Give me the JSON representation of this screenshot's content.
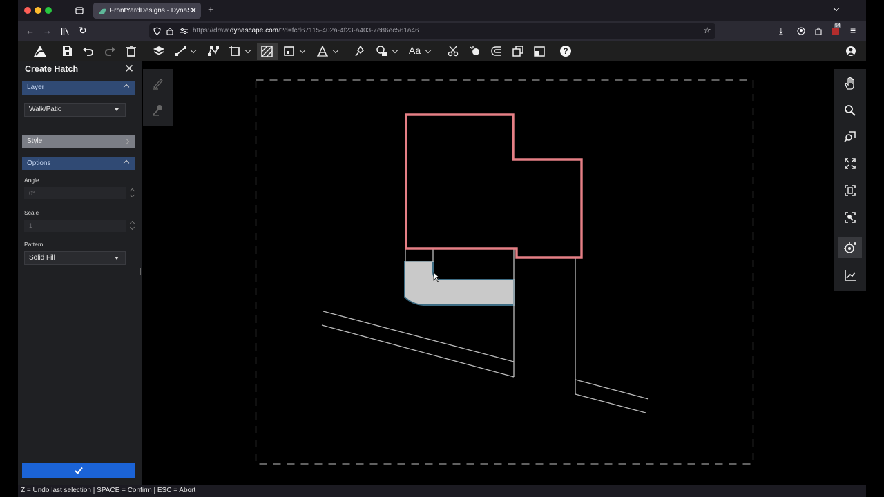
{
  "browser": {
    "tab_title": "FrontYardDesigns - DynaScape",
    "url_prefix": "https://draw.",
    "url_domain": "dynascape.com",
    "url_path": "/?d=fcd67115-402a-4f23-a403-7e86ec561a46",
    "notification_count": "54"
  },
  "panel": {
    "title": "Create Hatch",
    "layer_section": "Layer",
    "layer_value": "Walk/Patio",
    "style_section": "Style",
    "options_section": "Options",
    "angle_label": "Angle",
    "angle_value": "0°",
    "scale_label": "Scale",
    "scale_value": "1",
    "pattern_label": "Pattern",
    "pattern_value": "Solid Fill"
  },
  "toolbar": {
    "text_tool_label": "Aa",
    "help_label": "?"
  },
  "status_bar": "Z = Undo last selection | SPACE = Confirm | ESC = Abort",
  "colors": {
    "accent_blue": "#1b63d6",
    "section_header": "#304a74",
    "house_outline": "#e57f85",
    "hatch_fill": "#c9c9c9"
  }
}
